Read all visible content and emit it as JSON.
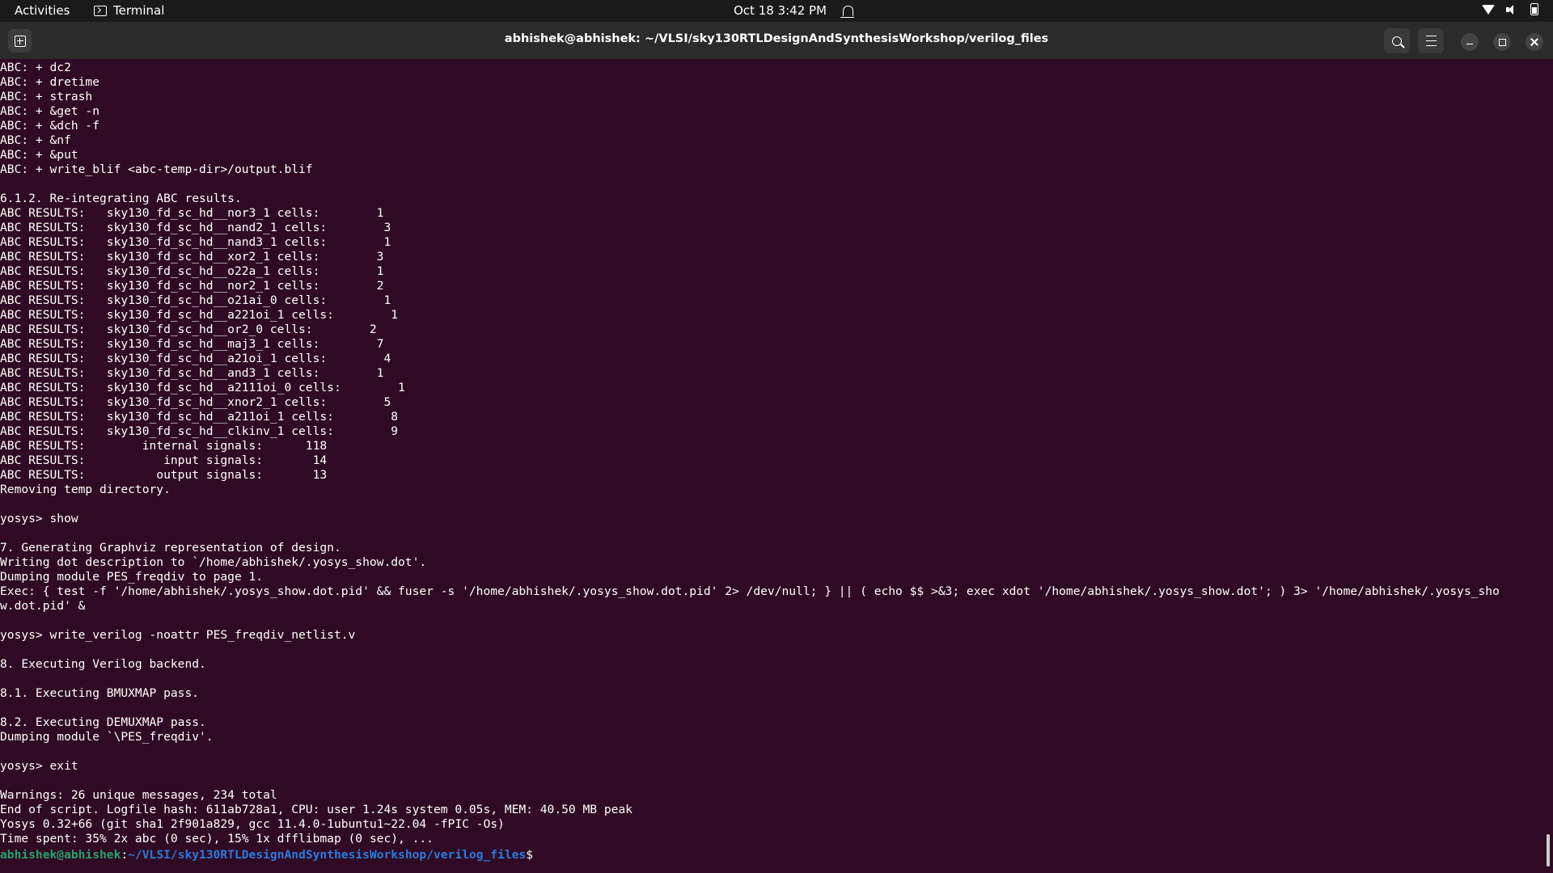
{
  "topbar": {
    "activities": "Activities",
    "app_name": "Terminal",
    "datetime": "Oct 18  3:42 PM"
  },
  "window": {
    "title": "abhishek@abhishek: ~/VLSI/sky130RTLDesignAndSynthesisWorkshop/verilog_files"
  },
  "terminal": {
    "lines": [
      "ABC: + dc2",
      "ABC: + dretime",
      "ABC: + strash",
      "ABC: + &get -n",
      "ABC: + &dch -f",
      "ABC: + &nf",
      "ABC: + &put",
      "ABC: + write_blif <abc-temp-dir>/output.blif",
      "",
      "6.1.2. Re-integrating ABC results.",
      "ABC RESULTS:   sky130_fd_sc_hd__nor3_1 cells:        1",
      "ABC RESULTS:   sky130_fd_sc_hd__nand2_1 cells:        3",
      "ABC RESULTS:   sky130_fd_sc_hd__nand3_1 cells:        1",
      "ABC RESULTS:   sky130_fd_sc_hd__xor2_1 cells:        3",
      "ABC RESULTS:   sky130_fd_sc_hd__o22a_1 cells:        1",
      "ABC RESULTS:   sky130_fd_sc_hd__nor2_1 cells:        2",
      "ABC RESULTS:   sky130_fd_sc_hd__o21ai_0 cells:        1",
      "ABC RESULTS:   sky130_fd_sc_hd__a221oi_1 cells:        1",
      "ABC RESULTS:   sky130_fd_sc_hd__or2_0 cells:        2",
      "ABC RESULTS:   sky130_fd_sc_hd__maj3_1 cells:        7",
      "ABC RESULTS:   sky130_fd_sc_hd__a21oi_1 cells:        4",
      "ABC RESULTS:   sky130_fd_sc_hd__and3_1 cells:        1",
      "ABC RESULTS:   sky130_fd_sc_hd__a2111oi_0 cells:        1",
      "ABC RESULTS:   sky130_fd_sc_hd__xnor2_1 cells:        5",
      "ABC RESULTS:   sky130_fd_sc_hd__a211oi_1 cells:        8",
      "ABC RESULTS:   sky130_fd_sc_hd__clkinv_1 cells:        9",
      "ABC RESULTS:        internal signals:      118",
      "ABC RESULTS:           input signals:       14",
      "ABC RESULTS:          output signals:       13",
      "Removing temp directory.",
      "",
      "yosys> show",
      "",
      "7. Generating Graphviz representation of design.",
      "Writing dot description to `/home/abhishek/.yosys_show.dot'.",
      "Dumping module PES_freqdiv to page 1.",
      "Exec: { test -f '/home/abhishek/.yosys_show.dot.pid' && fuser -s '/home/abhishek/.yosys_show.dot.pid' 2> /dev/null; } || ( echo $$ >&3; exec xdot '/home/abhishek/.yosys_show.dot'; ) 3> '/home/abhishek/.yosys_sho",
      "w.dot.pid' &",
      "",
      "yosys> write_verilog -noattr PES_freqdiv_netlist.v",
      "",
      "8. Executing Verilog backend.",
      "",
      "8.1. Executing BMUXMAP pass.",
      "",
      "8.2. Executing DEMUXMAP pass.",
      "Dumping module `\\PES_freqdiv'.",
      "",
      "yosys> exit",
      "",
      "Warnings: 26 unique messages, 234 total",
      "End of script. Logfile hash: 611ab728a1, CPU: user 1.24s system 0.05s, MEM: 40.50 MB peak",
      "Yosys 0.32+66 (git sha1 2f901a829, gcc 11.4.0-1ubuntu1~22.04 -fPIC -Os)",
      "Time spent: 35% 2x abc (0 sec), 15% 1x dfflibmap (0 sec), ..."
    ],
    "prompt": {
      "user_host": "abhishek@abhishek",
      "separator": ":",
      "path": "~/VLSI/sky130RTLDesignAndSynthesisWorkshop/verilog_files",
      "symbol": "$"
    }
  },
  "colors": {
    "terminal_bg": "#300a24",
    "titlebar_bg": "#2b2b2b",
    "topbar_bg": "#1a1a1a",
    "prompt_user": "#26a269",
    "prompt_path": "#2a7bde"
  },
  "icons": {
    "app": "terminal-icon",
    "notifications": "bell-icon",
    "network": "wifi-icon",
    "sound": "volume-icon",
    "power": "battery-icon",
    "new_tab": "new-tab-icon",
    "search": "search-icon",
    "menu": "hamburger-menu-icon",
    "minimize": "minimize-icon",
    "maximize": "maximize-icon",
    "close": "close-icon"
  }
}
